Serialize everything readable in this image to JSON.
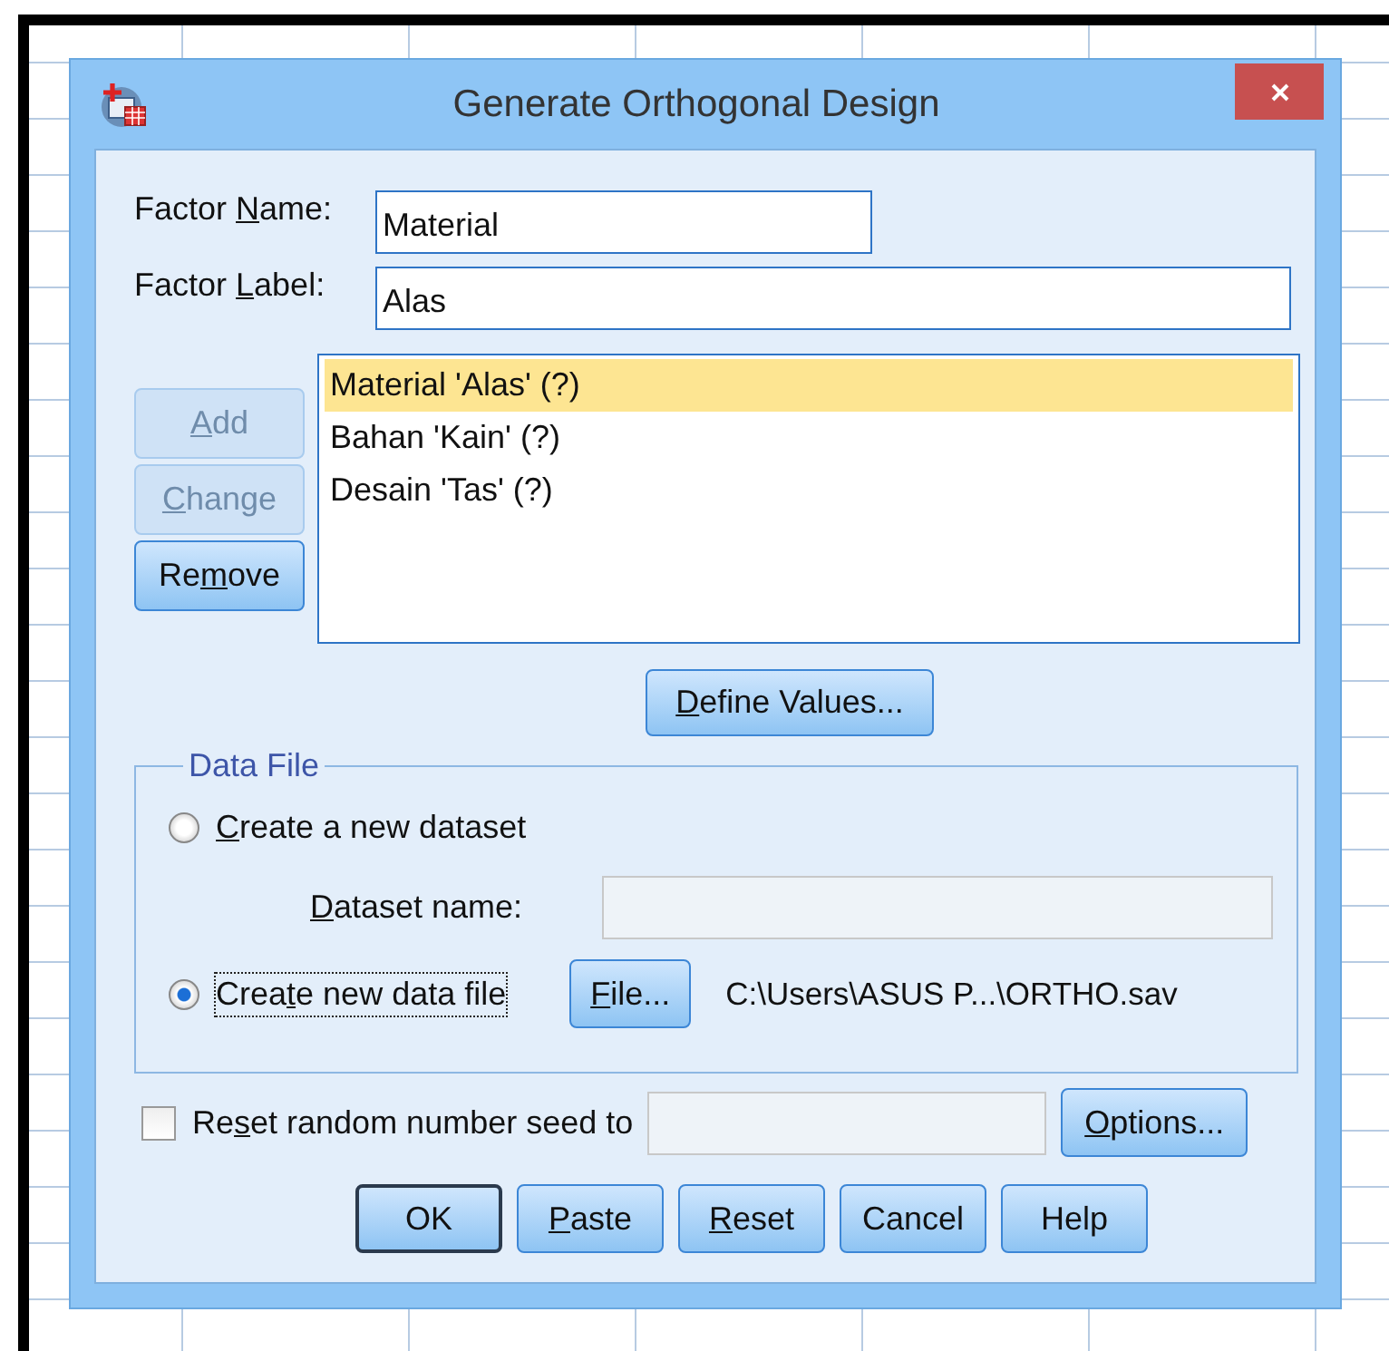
{
  "window": {
    "title": "Generate Orthogonal Design"
  },
  "factor_name": {
    "label": {
      "pre": "Factor ",
      "key": "N",
      "post": "ame:"
    },
    "value": "Material"
  },
  "factor_label": {
    "label": {
      "pre": "Factor ",
      "key": "L",
      "post": "abel:"
    },
    "value": "Alas"
  },
  "side_buttons": [
    {
      "label": {
        "key": "A",
        "post": "dd"
      },
      "disabled": true
    },
    {
      "label": {
        "key": "C",
        "post": "hange"
      },
      "disabled": true
    },
    {
      "label": {
        "pre": "Re",
        "key": "m",
        "post": "ove"
      },
      "disabled": false
    }
  ],
  "factors": [
    {
      "text": "Material 'Alas' (?)",
      "selected": true
    },
    {
      "text": "Bahan 'Kain' (?)",
      "selected": false
    },
    {
      "text": "Desain 'Tas' (?)",
      "selected": false
    }
  ],
  "define_values_button": {
    "label": {
      "key": "D",
      "post": "efine Values..."
    }
  },
  "data_file": {
    "title": "Data File",
    "new_dataset": {
      "label": {
        "key": "C",
        "post": "reate a new dataset"
      },
      "selected": false
    },
    "dataset_name": {
      "label": {
        "key": "D",
        "post": "ataset name:"
      },
      "disabled": true
    },
    "new_file": {
      "label": {
        "pre": "Crea",
        "key": "t",
        "post": "e new data file"
      },
      "selected": true,
      "focused": true
    },
    "file_button": {
      "label": {
        "key": "F",
        "post": "ile..."
      }
    },
    "file_path": "C:\\Users\\ASUS P...\\ORTHO.sav"
  },
  "reset_seed": {
    "label": {
      "pre": "Re",
      "key": "s",
      "post": "et random number seed to"
    },
    "checked": false
  },
  "options_button": {
    "label": {
      "key": "O",
      "post": "ptions..."
    }
  },
  "buttons": [
    {
      "label": "OK",
      "default": true
    },
    {
      "label": {
        "key": "P",
        "post": "aste"
      },
      "default": false
    },
    {
      "label": {
        "key": "R",
        "post": "eset"
      },
      "default": false
    },
    {
      "label": "Cancel",
      "default": false
    },
    {
      "label": "Help",
      "default": false
    }
  ]
}
